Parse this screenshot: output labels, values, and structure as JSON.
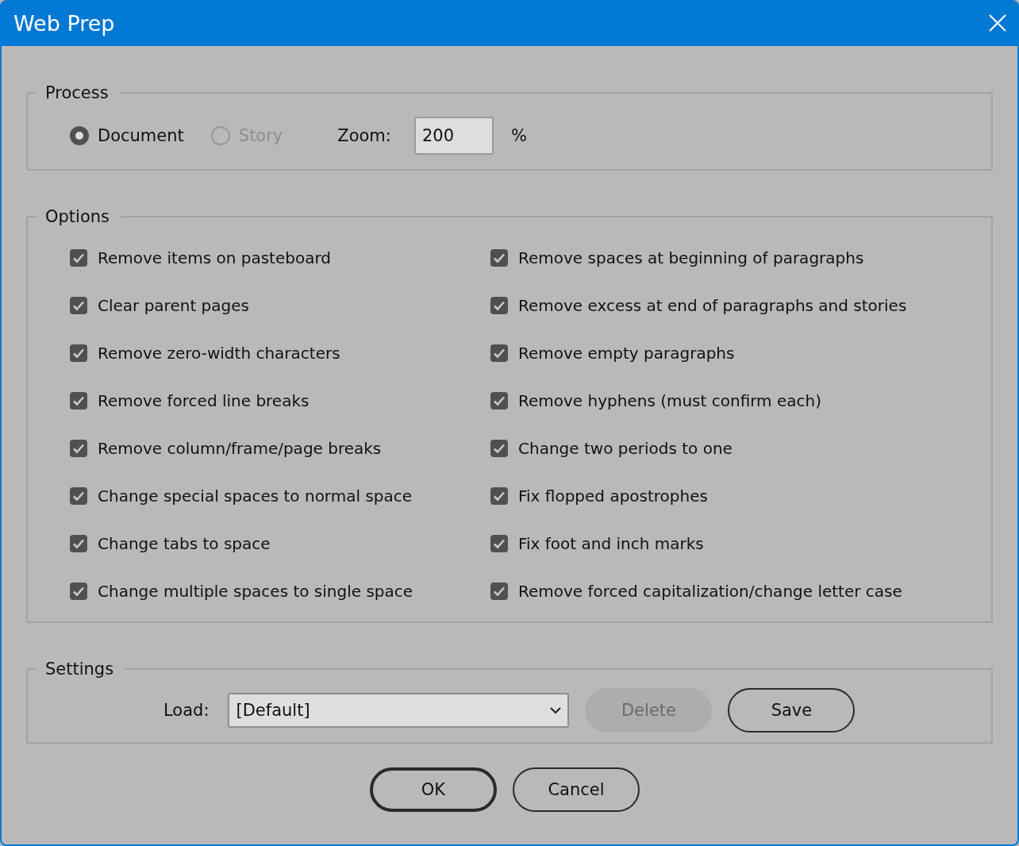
{
  "window": {
    "title": "Web Prep"
  },
  "process": {
    "title": "Process",
    "radios": [
      {
        "label": "Document",
        "selected": true,
        "disabled": false
      },
      {
        "label": "Story",
        "selected": false,
        "disabled": true
      }
    ],
    "zoom": {
      "label": "Zoom:",
      "value": "200",
      "unit": "%"
    }
  },
  "options": {
    "title": "Options",
    "columns": [
      {
        "items": [
          {
            "label": "Remove items on pasteboard",
            "checked": true
          },
          {
            "label": "Clear parent pages",
            "checked": true
          },
          {
            "label": "Remove zero-width characters",
            "checked": true
          },
          {
            "label": "Remove forced line breaks",
            "checked": true
          },
          {
            "label": "Remove column/frame/page breaks",
            "checked": true
          },
          {
            "label": "Change special spaces to normal space",
            "checked": true
          },
          {
            "label": "Change tabs to space",
            "checked": true
          },
          {
            "label": "Change multiple spaces to single space",
            "checked": true
          }
        ]
      },
      {
        "items": [
          {
            "label": "Remove spaces at beginning of paragraphs",
            "checked": true
          },
          {
            "label": "Remove excess at end of paragraphs and stories",
            "checked": true
          },
          {
            "label": "Remove empty paragraphs",
            "checked": true
          },
          {
            "label": "Remove hyphens (must confirm each)",
            "checked": true
          },
          {
            "label": "Change two periods to one",
            "checked": true
          },
          {
            "label": "Fix flopped apostrophes",
            "checked": true
          },
          {
            "label": "Fix foot and inch marks",
            "checked": true
          },
          {
            "label": "Remove forced capitalization/change letter case",
            "checked": true
          }
        ]
      }
    ]
  },
  "settings": {
    "title": "Settings",
    "load_label": "Load:",
    "load_value": "[Default]",
    "buttons": [
      {
        "label": "Delete",
        "disabled": true
      },
      {
        "label": "Save",
        "disabled": false
      }
    ]
  },
  "footer_buttons": [
    {
      "label": "OK",
      "default": true
    },
    {
      "label": "Cancel",
      "default": false
    }
  ]
}
